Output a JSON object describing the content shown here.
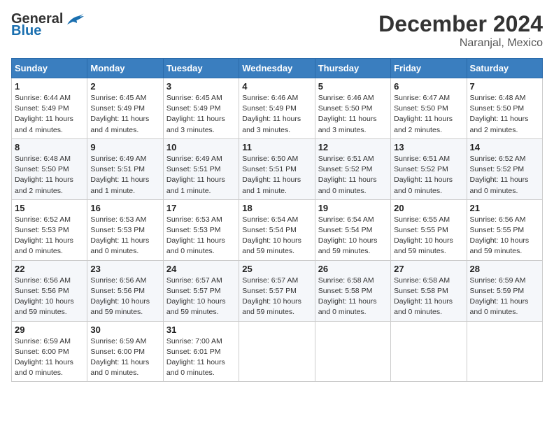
{
  "header": {
    "logo_general": "General",
    "logo_blue": "Blue",
    "title": "December 2024",
    "subtitle": "Naranjal, Mexico"
  },
  "columns": [
    "Sunday",
    "Monday",
    "Tuesday",
    "Wednesday",
    "Thursday",
    "Friday",
    "Saturday"
  ],
  "weeks": [
    [
      {
        "day": "1",
        "sunrise": "6:44 AM",
        "sunset": "5:49 PM",
        "daylight": "11 hours and 4 minutes."
      },
      {
        "day": "2",
        "sunrise": "6:45 AM",
        "sunset": "5:49 PM",
        "daylight": "11 hours and 4 minutes."
      },
      {
        "day": "3",
        "sunrise": "6:45 AM",
        "sunset": "5:49 PM",
        "daylight": "11 hours and 3 minutes."
      },
      {
        "day": "4",
        "sunrise": "6:46 AM",
        "sunset": "5:49 PM",
        "daylight": "11 hours and 3 minutes."
      },
      {
        "day": "5",
        "sunrise": "6:46 AM",
        "sunset": "5:50 PM",
        "daylight": "11 hours and 3 minutes."
      },
      {
        "day": "6",
        "sunrise": "6:47 AM",
        "sunset": "5:50 PM",
        "daylight": "11 hours and 2 minutes."
      },
      {
        "day": "7",
        "sunrise": "6:48 AM",
        "sunset": "5:50 PM",
        "daylight": "11 hours and 2 minutes."
      }
    ],
    [
      {
        "day": "8",
        "sunrise": "6:48 AM",
        "sunset": "5:50 PM",
        "daylight": "11 hours and 2 minutes."
      },
      {
        "day": "9",
        "sunrise": "6:49 AM",
        "sunset": "5:51 PM",
        "daylight": "11 hours and 1 minute."
      },
      {
        "day": "10",
        "sunrise": "6:49 AM",
        "sunset": "5:51 PM",
        "daylight": "11 hours and 1 minute."
      },
      {
        "day": "11",
        "sunrise": "6:50 AM",
        "sunset": "5:51 PM",
        "daylight": "11 hours and 1 minute."
      },
      {
        "day": "12",
        "sunrise": "6:51 AM",
        "sunset": "5:52 PM",
        "daylight": "11 hours and 0 minutes."
      },
      {
        "day": "13",
        "sunrise": "6:51 AM",
        "sunset": "5:52 PM",
        "daylight": "11 hours and 0 minutes."
      },
      {
        "day": "14",
        "sunrise": "6:52 AM",
        "sunset": "5:52 PM",
        "daylight": "11 hours and 0 minutes."
      }
    ],
    [
      {
        "day": "15",
        "sunrise": "6:52 AM",
        "sunset": "5:53 PM",
        "daylight": "11 hours and 0 minutes."
      },
      {
        "day": "16",
        "sunrise": "6:53 AM",
        "sunset": "5:53 PM",
        "daylight": "11 hours and 0 minutes."
      },
      {
        "day": "17",
        "sunrise": "6:53 AM",
        "sunset": "5:53 PM",
        "daylight": "11 hours and 0 minutes."
      },
      {
        "day": "18",
        "sunrise": "6:54 AM",
        "sunset": "5:54 PM",
        "daylight": "10 hours and 59 minutes."
      },
      {
        "day": "19",
        "sunrise": "6:54 AM",
        "sunset": "5:54 PM",
        "daylight": "10 hours and 59 minutes."
      },
      {
        "day": "20",
        "sunrise": "6:55 AM",
        "sunset": "5:55 PM",
        "daylight": "10 hours and 59 minutes."
      },
      {
        "day": "21",
        "sunrise": "6:56 AM",
        "sunset": "5:55 PM",
        "daylight": "10 hours and 59 minutes."
      }
    ],
    [
      {
        "day": "22",
        "sunrise": "6:56 AM",
        "sunset": "5:56 PM",
        "daylight": "10 hours and 59 minutes."
      },
      {
        "day": "23",
        "sunrise": "6:56 AM",
        "sunset": "5:56 PM",
        "daylight": "10 hours and 59 minutes."
      },
      {
        "day": "24",
        "sunrise": "6:57 AM",
        "sunset": "5:57 PM",
        "daylight": "10 hours and 59 minutes."
      },
      {
        "day": "25",
        "sunrise": "6:57 AM",
        "sunset": "5:57 PM",
        "daylight": "10 hours and 59 minutes."
      },
      {
        "day": "26",
        "sunrise": "6:58 AM",
        "sunset": "5:58 PM",
        "daylight": "11 hours and 0 minutes."
      },
      {
        "day": "27",
        "sunrise": "6:58 AM",
        "sunset": "5:58 PM",
        "daylight": "11 hours and 0 minutes."
      },
      {
        "day": "28",
        "sunrise": "6:59 AM",
        "sunset": "5:59 PM",
        "daylight": "11 hours and 0 minutes."
      }
    ],
    [
      {
        "day": "29",
        "sunrise": "6:59 AM",
        "sunset": "6:00 PM",
        "daylight": "11 hours and 0 minutes."
      },
      {
        "day": "30",
        "sunrise": "6:59 AM",
        "sunset": "6:00 PM",
        "daylight": "11 hours and 0 minutes."
      },
      {
        "day": "31",
        "sunrise": "7:00 AM",
        "sunset": "6:01 PM",
        "daylight": "11 hours and 0 minutes."
      },
      null,
      null,
      null,
      null
    ]
  ]
}
